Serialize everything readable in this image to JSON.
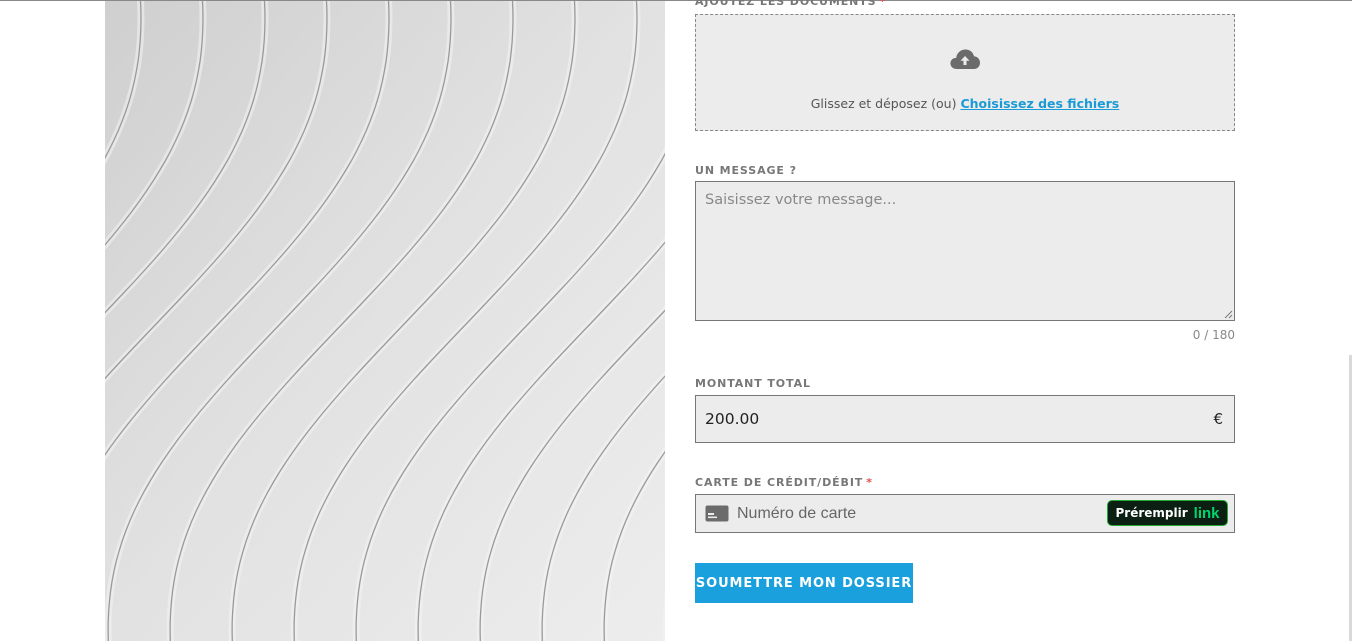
{
  "documents": {
    "label": "AJOUTEZ LES DOCUMENTS",
    "required_mark": "*",
    "icon": "cloud-upload-icon",
    "drop_text": "Glissez et déposez (ou)",
    "choose_link": "Choisissez des fichiers"
  },
  "message": {
    "label": "UN MESSAGE ?",
    "placeholder": "Saisissez votre message...",
    "value": "",
    "counter": "0 / 180"
  },
  "amount": {
    "label": "MONTANT TOTAL",
    "value": "200.00",
    "currency": "€"
  },
  "card": {
    "label": "CARTE DE CRÉDIT/DÉBIT",
    "required_mark": "*",
    "icon": "credit-card-icon",
    "placeholder": "Numéro de carte",
    "prefill_label": "Préremplir",
    "link_brand": "link"
  },
  "submit": {
    "label": "SOUMETTRE MON DOSSIER"
  },
  "colors": {
    "accent": "#1aa0dc",
    "required": "#e05252",
    "link_brand": "#00d66f",
    "field_bg": "#ececec"
  }
}
